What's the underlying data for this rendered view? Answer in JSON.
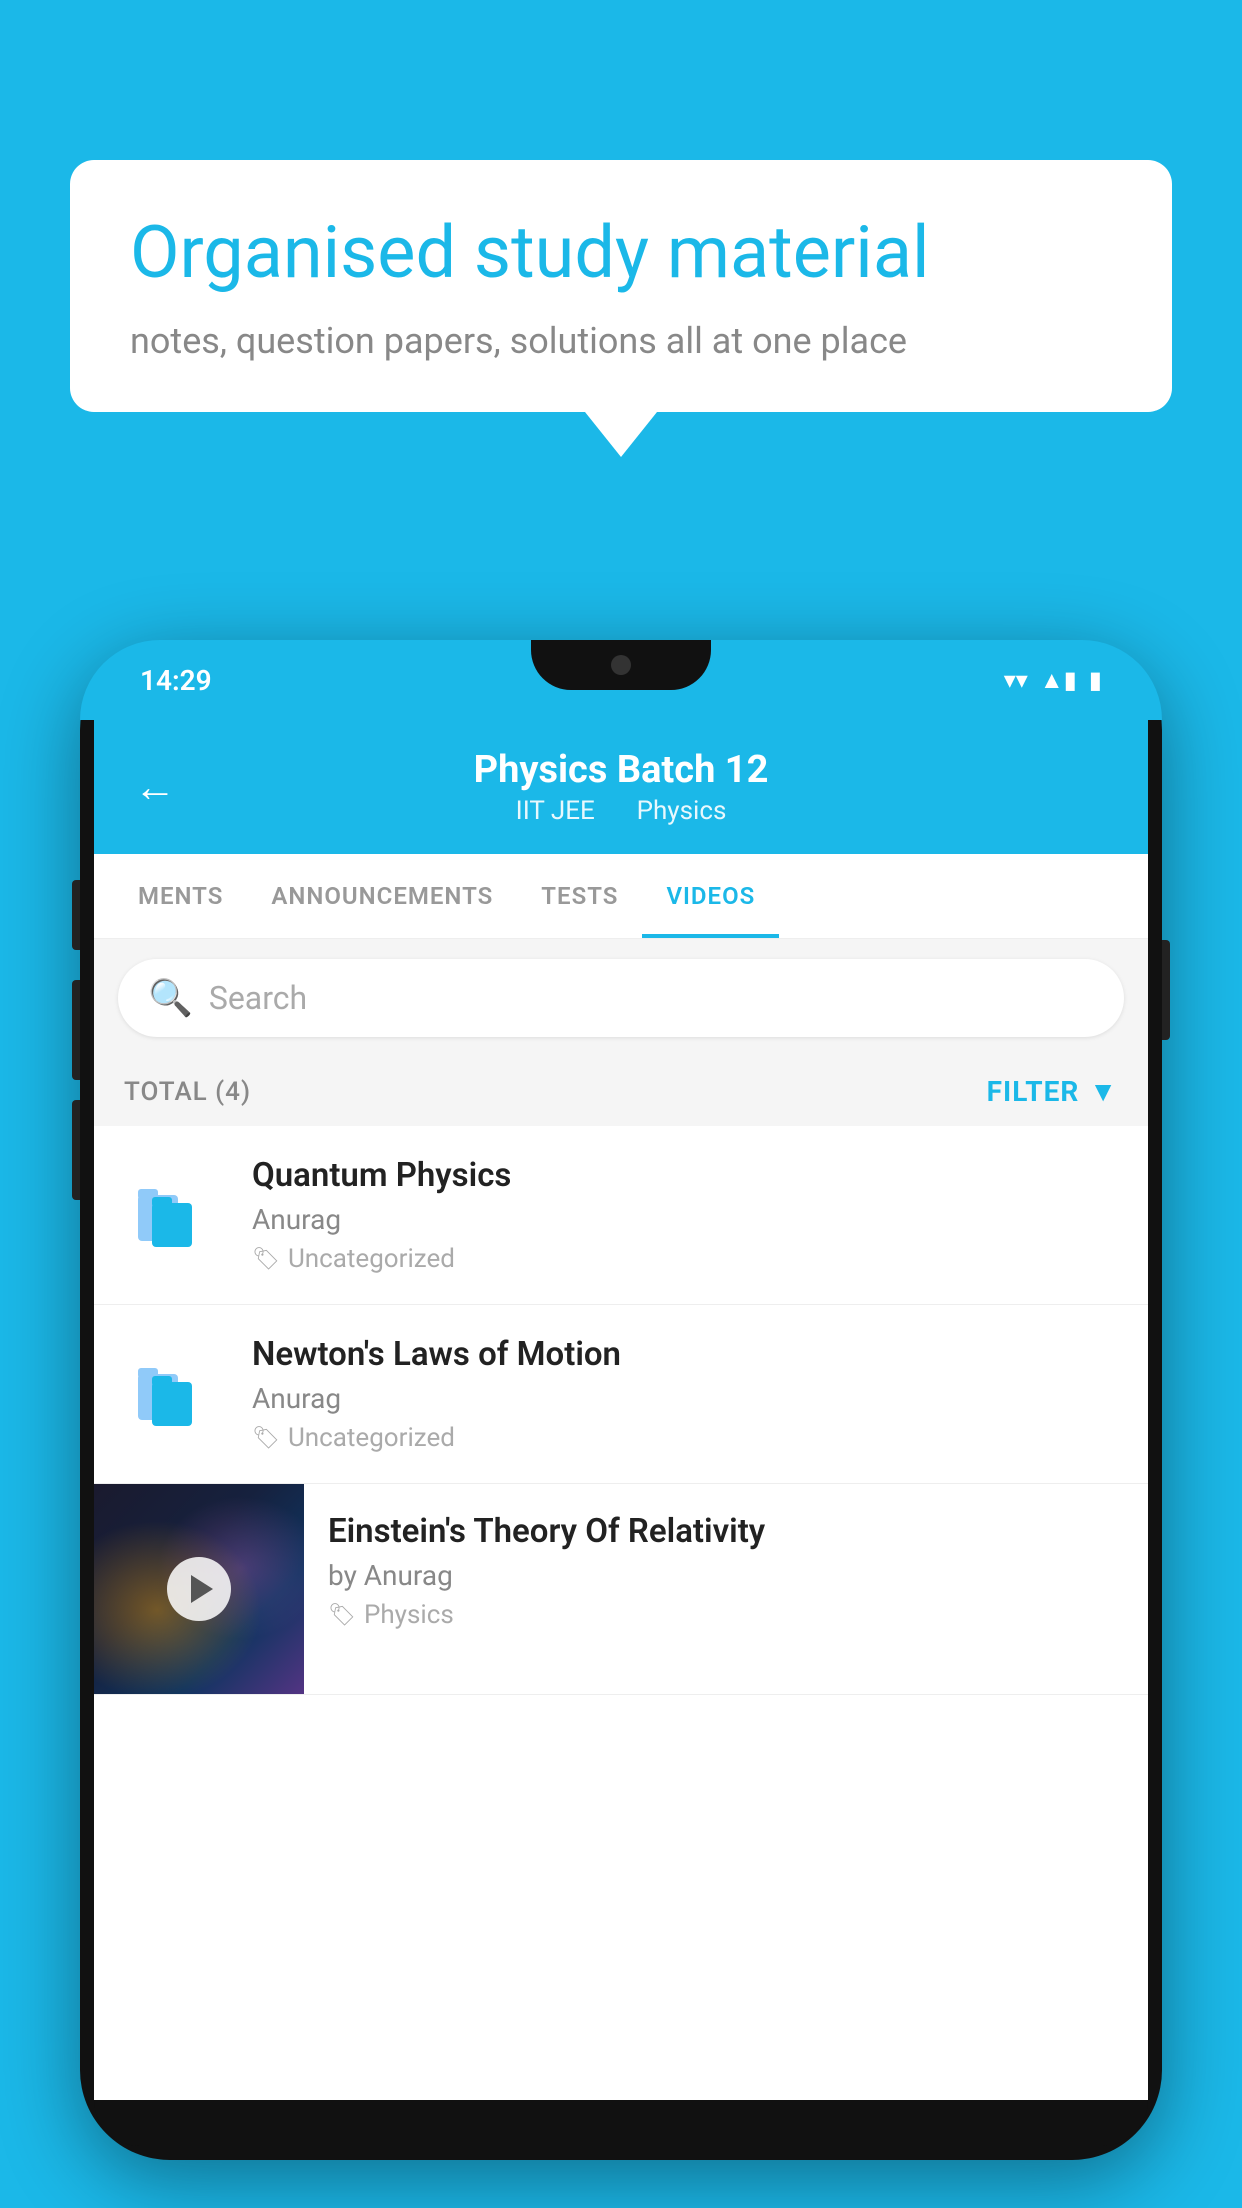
{
  "background_color": "#1BB8E8",
  "speech_bubble": {
    "title": "Organised study material",
    "subtitle": "notes, question papers, solutions all at one place"
  },
  "phone": {
    "status_bar": {
      "time": "14:29",
      "wifi_icon": "▼",
      "signal_icon": "▲",
      "battery_icon": "▮"
    },
    "header": {
      "back_label": "←",
      "title": "Physics Batch 12",
      "subtitle_left": "IIT JEE",
      "subtitle_right": "Physics"
    },
    "tabs": [
      {
        "label": "MENTS",
        "active": false
      },
      {
        "label": "ANNOUNCEMENTS",
        "active": false
      },
      {
        "label": "TESTS",
        "active": false
      },
      {
        "label": "VIDEOS",
        "active": true
      }
    ],
    "search": {
      "placeholder": "Search"
    },
    "filter_bar": {
      "total_label": "TOTAL (4)",
      "filter_label": "FILTER"
    },
    "video_items": [
      {
        "id": 1,
        "title": "Quantum Physics",
        "author": "Anurag",
        "tag": "Uncategorized",
        "has_thumbnail": false
      },
      {
        "id": 2,
        "title": "Newton's Laws of Motion",
        "author": "Anurag",
        "tag": "Uncategorized",
        "has_thumbnail": false
      },
      {
        "id": 3,
        "title": "Einstein's Theory Of Relativity",
        "author": "by Anurag",
        "tag": "Physics",
        "has_thumbnail": true
      }
    ]
  }
}
